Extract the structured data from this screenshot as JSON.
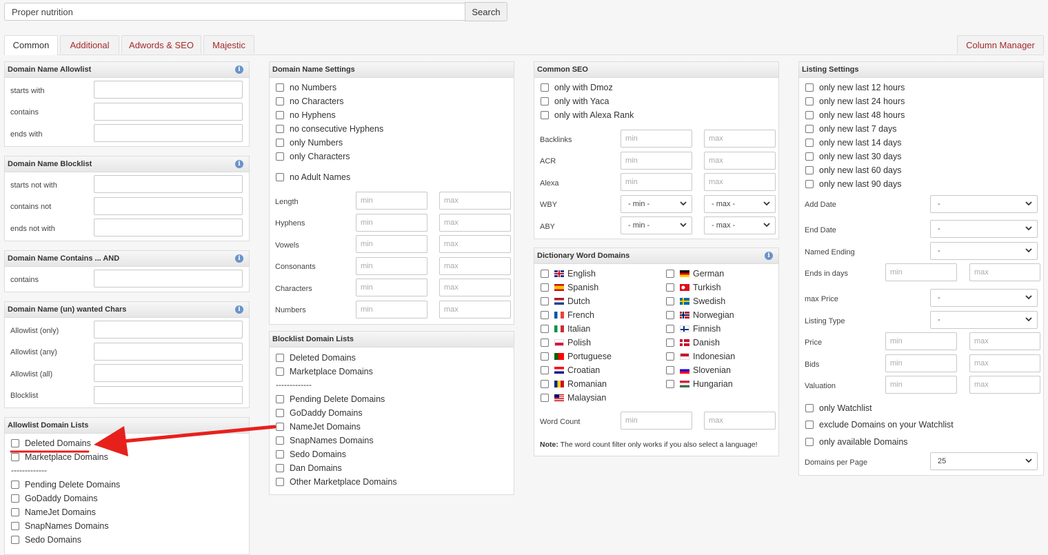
{
  "search": {
    "value": "Proper nutrition",
    "button": "Search"
  },
  "tabs": [
    "Common",
    "Additional",
    "Adwords & SEO",
    "Majestic"
  ],
  "column_manager": "Column Manager",
  "allowlist": {
    "title": "Domain Name Allowlist",
    "labels": [
      "starts with",
      "contains",
      "ends with"
    ]
  },
  "blocklist": {
    "title": "Domain Name Blocklist",
    "labels": [
      "starts not with",
      "contains not",
      "ends not with"
    ]
  },
  "contains_and": {
    "title": "Domain Name Contains ... AND",
    "labels": [
      "contains"
    ]
  },
  "unwanted": {
    "title": "Domain Name (un) wanted Chars",
    "labels": [
      "Allowlist (only)",
      "Allowlist (any)",
      "Allowlist (all)",
      "Blocklist"
    ]
  },
  "allow_lists": {
    "title": "Allowlist Domain Lists",
    "items": [
      "Deleted Domains",
      "Marketplace Domains",
      "-------------",
      "Pending Delete Domains",
      "GoDaddy Domains",
      "NameJet Domains",
      "SnapNames Domains",
      "Sedo Domains"
    ]
  },
  "name_settings": {
    "title": "Domain Name Settings",
    "checks": [
      "no Numbers",
      "no Characters",
      "no Hyphens",
      "no consecutive Hyphens",
      "only Numbers",
      "only Characters",
      "no Adult Names"
    ],
    "ranges": [
      "Length",
      "Hyphens",
      "Vowels",
      "Consonants",
      "Characters",
      "Numbers"
    ]
  },
  "block_lists": {
    "title": "Blocklist Domain Lists",
    "items": [
      "Deleted Domains",
      "Marketplace Domains",
      "-------------",
      "Pending Delete Domains",
      "GoDaddy Domains",
      "NameJet Domains",
      "SnapNames Domains",
      "Sedo Domains",
      "Dan Domains",
      "Other Marketplace Domains"
    ]
  },
  "placeholders": {
    "min": "min",
    "max": "max",
    "sel_min": "- min -",
    "sel_max": "- max -"
  },
  "common_seo": {
    "title": "Common SEO",
    "checks": [
      "only with Dmoz",
      "only with Yaca",
      "only with Alexa Rank"
    ],
    "ranges": [
      "Backlinks",
      "ACR",
      "Alexa"
    ],
    "selects": [
      "WBY",
      "ABY"
    ]
  },
  "dictionary": {
    "title": "Dictionary Word Domains",
    "left": [
      "English",
      "Spanish",
      "Dutch",
      "French",
      "Italian",
      "Polish",
      "Portuguese",
      "Croatian",
      "Romanian",
      "Malaysian"
    ],
    "right": [
      "German",
      "Turkish",
      "Swedish",
      "Norwegian",
      "Finnish",
      "Danish",
      "Indonesian",
      "Slovenian",
      "Hungarian"
    ],
    "word_count": "Word Count",
    "note_bold": "Note:",
    "note": " The word count filter only works if you also select a language!"
  },
  "listing": {
    "title": "Listing Settings",
    "checks": [
      "only new last 12 hours",
      "only new last 24 hours",
      "only new last 48 hours",
      "only new last 7 days",
      "only new last 14 days",
      "only new last 30 days",
      "only new last 60 days",
      "only new last 90 days"
    ],
    "add_date": "Add Date",
    "end_date": "End Date",
    "named_ending": "Named Ending",
    "ends_in_days": "Ends in days",
    "max_price": "max Price",
    "listing_type": "Listing Type",
    "ranges": [
      "Price",
      "Bids",
      "Valuation"
    ],
    "checks2": [
      "only Watchlist",
      "exclude Domains on your Watchlist",
      "only available Domains"
    ],
    "per_page": "Domains per Page",
    "per_page_value": "25",
    "dash": "-"
  },
  "colors": {
    "accent": "#a52a2a",
    "arrow": "#e8201c",
    "info": "#6a93c9"
  }
}
